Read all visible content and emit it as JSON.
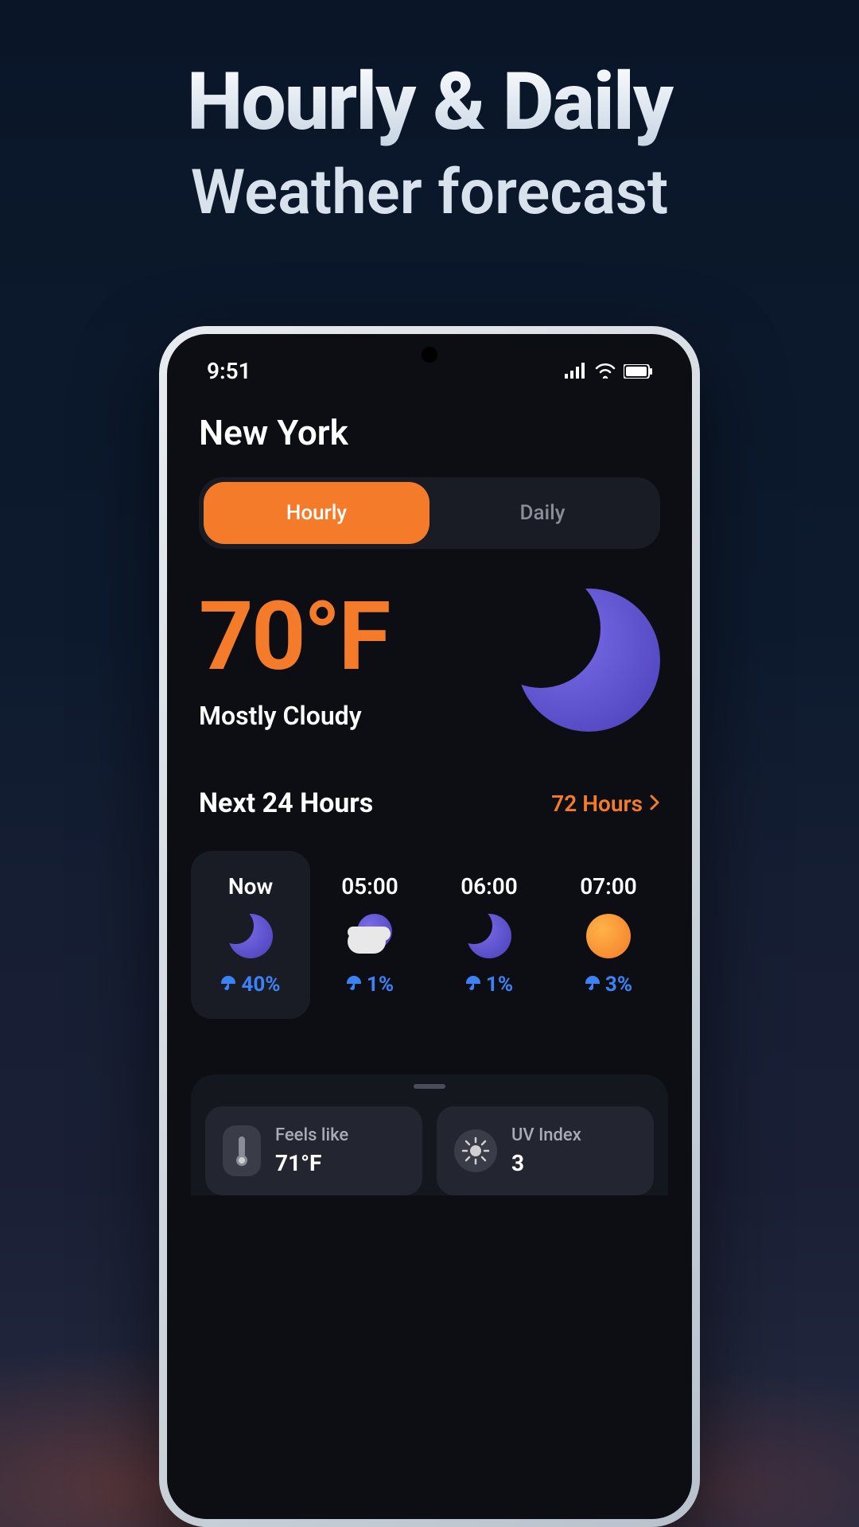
{
  "headline": {
    "title": "Hourly & Daily",
    "subtitle": "Weather forecast"
  },
  "statusbar": {
    "time": "9:51"
  },
  "location": "New York",
  "tabs": {
    "hourly": "Hourly",
    "daily": "Daily",
    "active": "hourly"
  },
  "current": {
    "temperature": "70°F",
    "condition": "Mostly Cloudy",
    "icon": "moon"
  },
  "section": {
    "title": "Next 24 Hours",
    "link": "72 Hours"
  },
  "hourly": [
    {
      "time": "Now",
      "icon": "moon",
      "precip": "40%",
      "active": true
    },
    {
      "time": "05:00",
      "icon": "cloud-moon",
      "precip": "1%",
      "active": false
    },
    {
      "time": "06:00",
      "icon": "moon",
      "precip": "1%",
      "active": false
    },
    {
      "time": "07:00",
      "icon": "sun",
      "precip": "3%",
      "active": false
    }
  ],
  "metrics": {
    "feels_like": {
      "label": "Feels like",
      "value": "71°F"
    },
    "uv_index": {
      "label": "UV Index",
      "value": "3"
    }
  },
  "colors": {
    "accent": "#f47b2a",
    "link_blue": "#3b82f6",
    "screen_bg": "#0d0e14"
  }
}
